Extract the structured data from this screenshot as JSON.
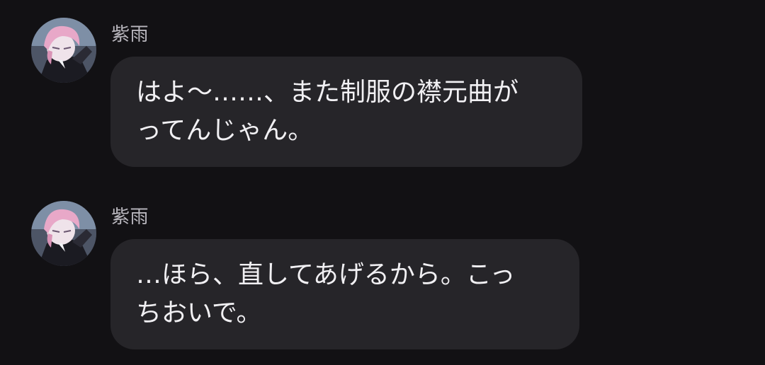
{
  "messages": [
    {
      "sender": "紫雨",
      "avatar_icon": "character-avatar-icon",
      "lines": [
        "はよ〜……、また制服の襟元曲が",
        "ってんじゃん。"
      ]
    },
    {
      "sender": "紫雨",
      "avatar_icon": "character-avatar-icon",
      "lines": [
        "…ほら、直してあげるから。こっ",
        "ちおいで。"
      ]
    }
  ],
  "colors": {
    "background": "#121114",
    "bubble": "#262529",
    "name_text": "#b9b7be",
    "message_text": "#f1f0f3",
    "avatar_accent": "#e8a8c8"
  }
}
